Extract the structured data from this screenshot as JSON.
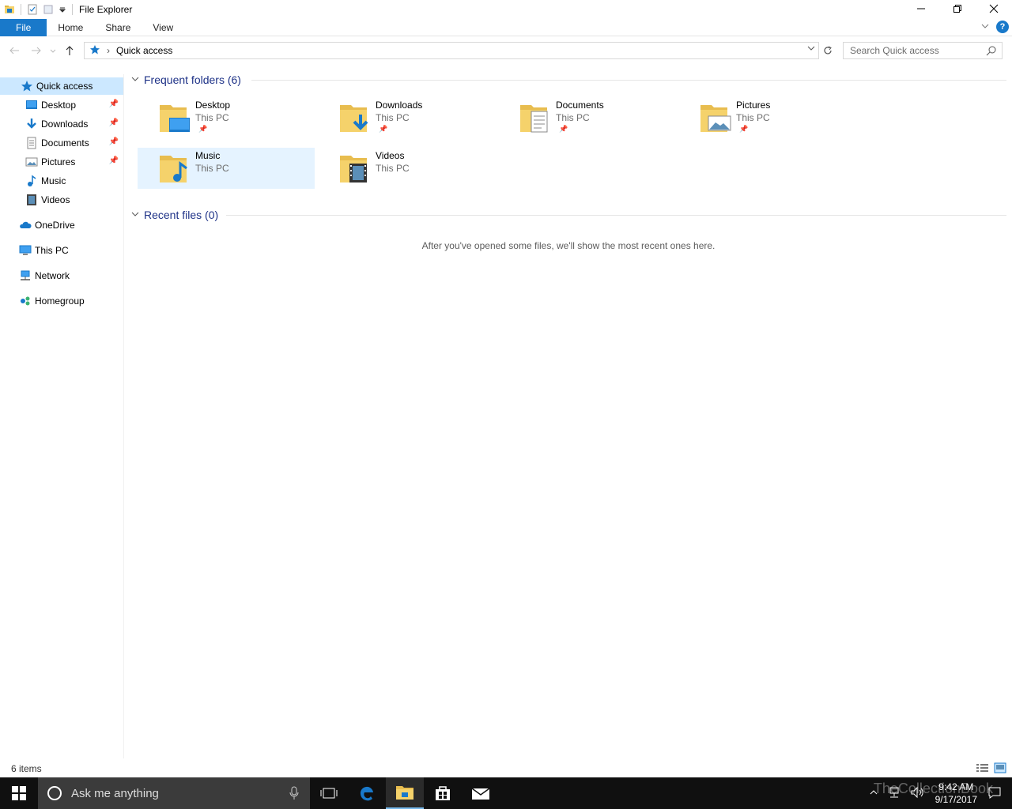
{
  "window": {
    "title": "File Explorer",
    "minimize": "—",
    "restore": "❐",
    "close": "✕"
  },
  "ribbon": {
    "tabs": [
      "File",
      "Home",
      "Share",
      "View"
    ],
    "help": "?"
  },
  "address": {
    "location": "Quick access",
    "search_placeholder": "Search Quick access"
  },
  "nav": {
    "quick_access": "Quick access",
    "pinned": [
      {
        "label": "Desktop",
        "icon": "desktop-icon",
        "pinned": true
      },
      {
        "label": "Downloads",
        "icon": "downloads-icon",
        "pinned": true
      },
      {
        "label": "Documents",
        "icon": "documents-icon",
        "pinned": true
      },
      {
        "label": "Pictures",
        "icon": "pictures-icon",
        "pinned": true
      },
      {
        "label": "Music",
        "icon": "music-icon",
        "pinned": false
      },
      {
        "label": "Videos",
        "icon": "videos-icon",
        "pinned": false
      }
    ],
    "onedrive": "OneDrive",
    "thispc": "This PC",
    "network": "Network",
    "homegroup": "Homegroup"
  },
  "content": {
    "frequent_header": "Frequent folders (6)",
    "recent_header": "Recent files (0)",
    "empty_message": "After you've opened some files, we'll show the most recent ones here.",
    "folders": [
      {
        "name": "Desktop",
        "location": "This PC",
        "pinned": true
      },
      {
        "name": "Downloads",
        "location": "This PC",
        "pinned": true
      },
      {
        "name": "Documents",
        "location": "This PC",
        "pinned": true
      },
      {
        "name": "Pictures",
        "location": "This PC",
        "pinned": true
      },
      {
        "name": "Music",
        "location": "This PC",
        "pinned": false
      },
      {
        "name": "Videos",
        "location": "This PC",
        "pinned": false
      }
    ]
  },
  "status": {
    "items": "6 items"
  },
  "taskbar": {
    "cortana_placeholder": "Ask me anything",
    "time": "9:42 AM",
    "date": "9/17/2017",
    "watermark": "TheCollectionBook"
  },
  "colors": {
    "accent": "#1979ca",
    "selection": "#cce8ff",
    "group_header": "#1e3287",
    "folder": "#f5d26b"
  }
}
